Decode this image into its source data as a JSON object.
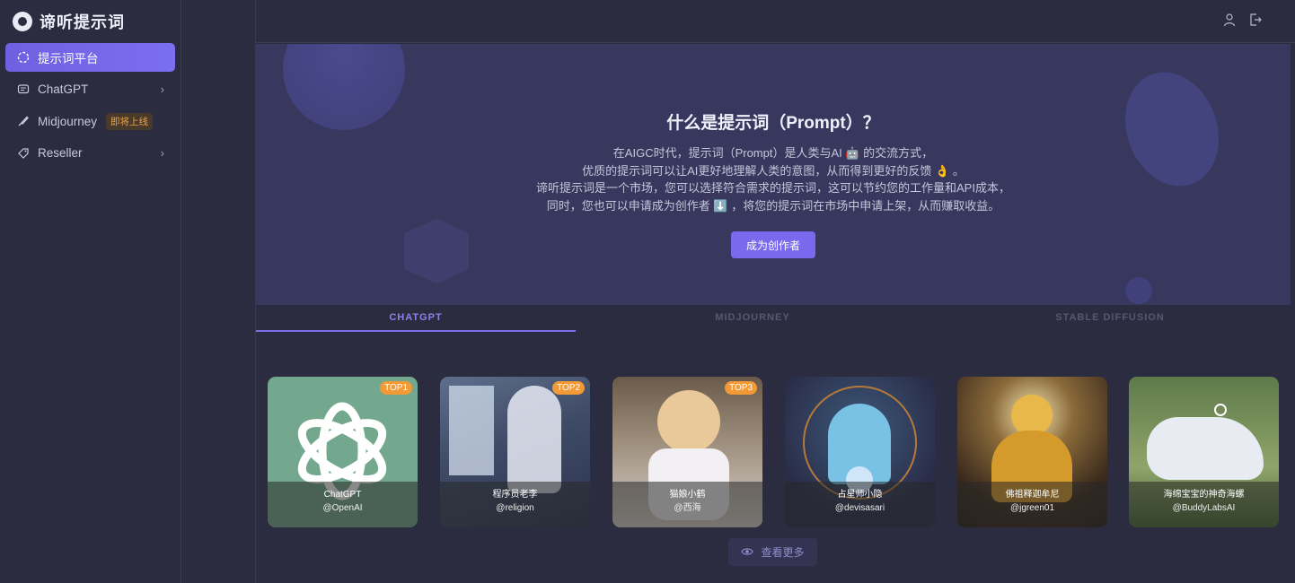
{
  "app": {
    "name": "谛听提示词"
  },
  "sidebar": {
    "items": [
      {
        "label": "提示词平台",
        "icon": "platform-icon",
        "active": true
      },
      {
        "label": "ChatGPT",
        "icon": "chat-icon",
        "has_children": true
      },
      {
        "label": "Midjourney",
        "icon": "brush-icon",
        "badge": "即将上线"
      },
      {
        "label": "Reseller",
        "icon": "tag-icon",
        "has_children": true
      }
    ]
  },
  "topbar": {
    "icons": [
      "user-icon",
      "logout-icon"
    ]
  },
  "hero": {
    "title": "什么是提示词（Prompt）？",
    "line1": "在AIGC时代，提示词（Prompt）是人类与AI 🤖 的交流方式，",
    "line2": "优质的提示词可以让AI更好地理解人类的意图，从而得到更好的反馈 👌 。",
    "line3": "谛听提示词是一个市场，您可以选择符合需求的提示词，这可以节约您的工作量和API成本，",
    "line4": "同时，您也可以申请成为创作者 ⬇️ ，将您的提示词在市场中申请上架，从而赚取收益。",
    "cta": "成为创作者"
  },
  "tabs": [
    {
      "label": "CHATGPT",
      "active": true
    },
    {
      "label": "MIDJOURNEY",
      "active": false
    },
    {
      "label": "STABLE DIFFUSION",
      "active": false
    }
  ],
  "cards": [
    {
      "name": "ChatGPT",
      "author": "@OpenAI",
      "badge": "TOP1"
    },
    {
      "name": "程序员老李",
      "author": "@religion",
      "badge": "TOP2"
    },
    {
      "name": "猫娘小鹤",
      "author": "@西海",
      "badge": "TOP3"
    },
    {
      "name": "占星师小隐",
      "author": "@devisasari",
      "badge": ""
    },
    {
      "name": "佛祖释迦牟尼",
      "author": "@jgreen01",
      "badge": ""
    },
    {
      "name": "海绵宝宝的神奇海螺",
      "author": "@BuddyLabsAI",
      "badge": ""
    }
  ],
  "more_button": {
    "label": "查看更多",
    "icon": "eye-icon"
  },
  "colors": {
    "accent": "#7a68ee",
    "badge": "#f29a36",
    "sidebar_bg": "#2b2c3f",
    "hero_bg": "#38385f"
  }
}
